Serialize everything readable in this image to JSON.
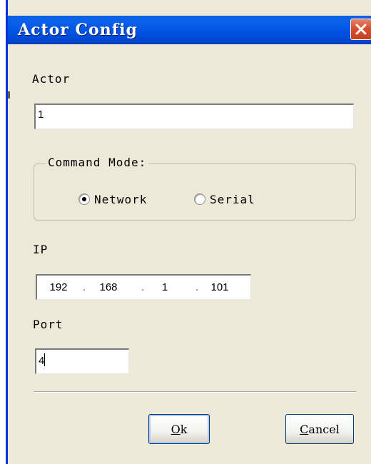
{
  "dialog": {
    "title": "Actor Config",
    "close_icon": "close-icon"
  },
  "actor": {
    "label": "Actor",
    "value": "1"
  },
  "command_mode": {
    "legend": "Command Mode:",
    "options": [
      {
        "label": "Network",
        "selected": true
      },
      {
        "label": "Serial",
        "selected": false
      }
    ]
  },
  "ip": {
    "label": "IP",
    "octets": [
      "192",
      "168",
      "1",
      "101"
    ],
    "separator": "."
  },
  "port": {
    "label": "Port",
    "value": "4"
  },
  "buttons": {
    "ok_mnemonic": "O",
    "ok_rest": "k",
    "cancel_mnemonic": "C",
    "cancel_rest": "ancel"
  },
  "colors": {
    "titlebar": "#0054e3",
    "close_button": "#d8502e",
    "dialog_background": "#ece9d8"
  }
}
